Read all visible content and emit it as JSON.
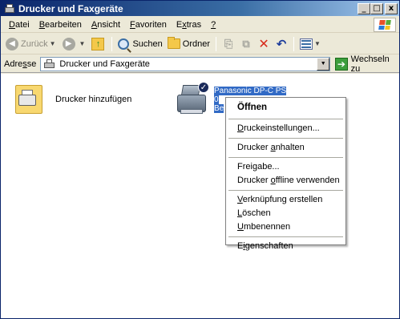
{
  "window": {
    "title": "Drucker und Faxgeräte",
    "controls": {
      "minimize": "_",
      "maximize": "□",
      "close": "x"
    }
  },
  "menubar": {
    "items": [
      {
        "pre": "",
        "ul": "D",
        "post": "atei"
      },
      {
        "pre": "",
        "ul": "B",
        "post": "earbeiten"
      },
      {
        "pre": "",
        "ul": "A",
        "post": "nsicht"
      },
      {
        "pre": "",
        "ul": "F",
        "post": "avoriten"
      },
      {
        "pre": "E",
        "ul": "x",
        "post": "tras"
      },
      {
        "pre": "",
        "ul": "?",
        "post": ""
      }
    ]
  },
  "toolbar": {
    "back_label": "Zurück",
    "search_label": "Suchen",
    "folders_label": "Ordner"
  },
  "addressbar": {
    "label_pre": "Adre",
    "label_ul": "s",
    "label_post": "se",
    "value": "Drucker und Faxgeräte",
    "go_label": "Wechseln zu"
  },
  "content": {
    "add_printer_label": "Drucker hinzufügen",
    "printer_label_lines": [
      "Panasonic DP-C    PS",
      "0",
      "Be"
    ]
  },
  "context_menu": {
    "open": "Öffnen",
    "items": [
      {
        "pre": "",
        "ul": "D",
        "post": "ruckeinstellungen..."
      },
      {
        "pre": "Drucker ",
        "ul": "a",
        "post": "nhalten"
      },
      {
        "pre": "Frei",
        "ul": "g",
        "post": "abe..."
      },
      {
        "pre": "Drucker ",
        "ul": "o",
        "post": "ffline verwenden"
      },
      {
        "pre": "",
        "ul": "V",
        "post": "erknüpfung erstellen"
      },
      {
        "pre": "",
        "ul": "L",
        "post": "öschen"
      },
      {
        "pre": "",
        "ul": "U",
        "post": "mbenennen"
      },
      {
        "pre": "E",
        "ul": "i",
        "post": "genschaften"
      }
    ]
  },
  "colors": {
    "title_start": "#0a246a",
    "selection": "#316ac5",
    "chrome": "#ece9d8"
  }
}
